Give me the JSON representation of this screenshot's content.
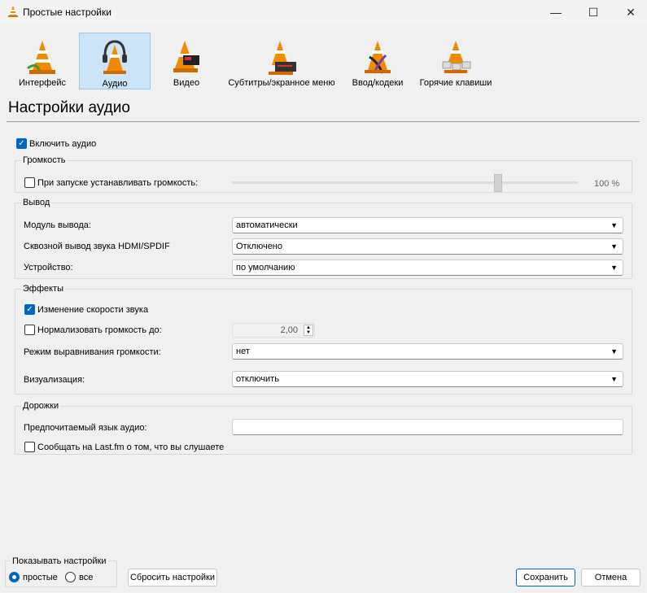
{
  "window": {
    "title": "Простые настройки",
    "minimize": "—",
    "maximize": "☐",
    "close": "✕"
  },
  "categories": [
    {
      "label": "Интерфейс",
      "icon": "cone-interface-icon"
    },
    {
      "label": "Аудио",
      "icon": "cone-headphones-icon"
    },
    {
      "label": "Видео",
      "icon": "cone-video-icon"
    },
    {
      "label": "Субтитры/экранное меню",
      "icon": "cone-subtitles-icon"
    },
    {
      "label": "Ввод/кодеки",
      "icon": "cone-cables-icon"
    },
    {
      "label": "Горячие клавиши",
      "icon": "cone-hotkeys-icon"
    }
  ],
  "section_title": "Настройки аудио",
  "enable_audio": {
    "label": "Включить аудио",
    "checked": true
  },
  "volume": {
    "group": "Громкость",
    "startup_label": "При запуске устанавливать громкость:",
    "startup_checked": false,
    "value": "100 %",
    "slider_fraction": 0.77
  },
  "output": {
    "group": "Вывод",
    "module_label": "Модуль вывода:",
    "module_value": "автоматически",
    "passthrough_label": "Сквозной вывод звука HDMI/SPDIF",
    "passthrough_value": "Отключено",
    "device_label": "Устройство:",
    "device_value": "по умолчанию"
  },
  "effects": {
    "group": "Эффекты",
    "speed_label": "Изменение скорости звука",
    "speed_checked": true,
    "normalize_label": "Нормализовать громкость до:",
    "normalize_checked": false,
    "normalize_value": "2,00",
    "replay_label": "Режим выравнивания громкости:",
    "replay_value": "нет",
    "visual_label": "Визуализация:",
    "visual_value": "отключить"
  },
  "tracks": {
    "group": "Дорожки",
    "lang_label": "Предпочитаемый язык аудио:",
    "lang_value": "",
    "lastfm_label": "Сообщать на Last.fm о том, что вы слушаете",
    "lastfm_checked": false
  },
  "footer": {
    "show_group": "Показывать настройки",
    "simple": "простые",
    "all": "все",
    "reset": "Сбросить настройки",
    "save": "Сохранить",
    "cancel": "Отмена"
  },
  "colors": {
    "accent": "#0067c0",
    "selected_bg": "#cce4f7",
    "cone_orange": "#f08a00"
  }
}
